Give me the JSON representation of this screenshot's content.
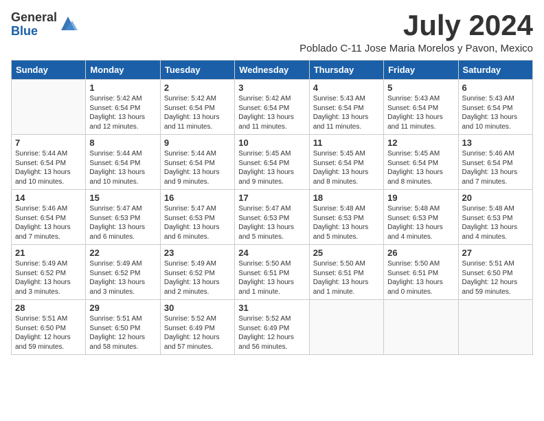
{
  "logo": {
    "general": "General",
    "blue": "Blue"
  },
  "title": "July 2024",
  "subtitle": "Poblado C-11 Jose Maria Morelos y Pavon, Mexico",
  "days_of_week": [
    "Sunday",
    "Monday",
    "Tuesday",
    "Wednesday",
    "Thursday",
    "Friday",
    "Saturday"
  ],
  "weeks": [
    [
      {
        "day": "",
        "info": ""
      },
      {
        "day": "1",
        "info": "Sunrise: 5:42 AM\nSunset: 6:54 PM\nDaylight: 13 hours\nand 12 minutes."
      },
      {
        "day": "2",
        "info": "Sunrise: 5:42 AM\nSunset: 6:54 PM\nDaylight: 13 hours\nand 11 minutes."
      },
      {
        "day": "3",
        "info": "Sunrise: 5:42 AM\nSunset: 6:54 PM\nDaylight: 13 hours\nand 11 minutes."
      },
      {
        "day": "4",
        "info": "Sunrise: 5:43 AM\nSunset: 6:54 PM\nDaylight: 13 hours\nand 11 minutes."
      },
      {
        "day": "5",
        "info": "Sunrise: 5:43 AM\nSunset: 6:54 PM\nDaylight: 13 hours\nand 11 minutes."
      },
      {
        "day": "6",
        "info": "Sunrise: 5:43 AM\nSunset: 6:54 PM\nDaylight: 13 hours\nand 10 minutes."
      }
    ],
    [
      {
        "day": "7",
        "info": "Sunrise: 5:44 AM\nSunset: 6:54 PM\nDaylight: 13 hours\nand 10 minutes."
      },
      {
        "day": "8",
        "info": "Sunrise: 5:44 AM\nSunset: 6:54 PM\nDaylight: 13 hours\nand 10 minutes."
      },
      {
        "day": "9",
        "info": "Sunrise: 5:44 AM\nSunset: 6:54 PM\nDaylight: 13 hours\nand 9 minutes."
      },
      {
        "day": "10",
        "info": "Sunrise: 5:45 AM\nSunset: 6:54 PM\nDaylight: 13 hours\nand 9 minutes."
      },
      {
        "day": "11",
        "info": "Sunrise: 5:45 AM\nSunset: 6:54 PM\nDaylight: 13 hours\nand 8 minutes."
      },
      {
        "day": "12",
        "info": "Sunrise: 5:45 AM\nSunset: 6:54 PM\nDaylight: 13 hours\nand 8 minutes."
      },
      {
        "day": "13",
        "info": "Sunrise: 5:46 AM\nSunset: 6:54 PM\nDaylight: 13 hours\nand 7 minutes."
      }
    ],
    [
      {
        "day": "14",
        "info": "Sunrise: 5:46 AM\nSunset: 6:54 PM\nDaylight: 13 hours\nand 7 minutes."
      },
      {
        "day": "15",
        "info": "Sunrise: 5:47 AM\nSunset: 6:53 PM\nDaylight: 13 hours\nand 6 minutes."
      },
      {
        "day": "16",
        "info": "Sunrise: 5:47 AM\nSunset: 6:53 PM\nDaylight: 13 hours\nand 6 minutes."
      },
      {
        "day": "17",
        "info": "Sunrise: 5:47 AM\nSunset: 6:53 PM\nDaylight: 13 hours\nand 5 minutes."
      },
      {
        "day": "18",
        "info": "Sunrise: 5:48 AM\nSunset: 6:53 PM\nDaylight: 13 hours\nand 5 minutes."
      },
      {
        "day": "19",
        "info": "Sunrise: 5:48 AM\nSunset: 6:53 PM\nDaylight: 13 hours\nand 4 minutes."
      },
      {
        "day": "20",
        "info": "Sunrise: 5:48 AM\nSunset: 6:53 PM\nDaylight: 13 hours\nand 4 minutes."
      }
    ],
    [
      {
        "day": "21",
        "info": "Sunrise: 5:49 AM\nSunset: 6:52 PM\nDaylight: 13 hours\nand 3 minutes."
      },
      {
        "day": "22",
        "info": "Sunrise: 5:49 AM\nSunset: 6:52 PM\nDaylight: 13 hours\nand 3 minutes."
      },
      {
        "day": "23",
        "info": "Sunrise: 5:49 AM\nSunset: 6:52 PM\nDaylight: 13 hours\nand 2 minutes."
      },
      {
        "day": "24",
        "info": "Sunrise: 5:50 AM\nSunset: 6:51 PM\nDaylight: 13 hours\nand 1 minute."
      },
      {
        "day": "25",
        "info": "Sunrise: 5:50 AM\nSunset: 6:51 PM\nDaylight: 13 hours\nand 1 minute."
      },
      {
        "day": "26",
        "info": "Sunrise: 5:50 AM\nSunset: 6:51 PM\nDaylight: 13 hours\nand 0 minutes."
      },
      {
        "day": "27",
        "info": "Sunrise: 5:51 AM\nSunset: 6:50 PM\nDaylight: 12 hours\nand 59 minutes."
      }
    ],
    [
      {
        "day": "28",
        "info": "Sunrise: 5:51 AM\nSunset: 6:50 PM\nDaylight: 12 hours\nand 59 minutes."
      },
      {
        "day": "29",
        "info": "Sunrise: 5:51 AM\nSunset: 6:50 PM\nDaylight: 12 hours\nand 58 minutes."
      },
      {
        "day": "30",
        "info": "Sunrise: 5:52 AM\nSunset: 6:49 PM\nDaylight: 12 hours\nand 57 minutes."
      },
      {
        "day": "31",
        "info": "Sunrise: 5:52 AM\nSunset: 6:49 PM\nDaylight: 12 hours\nand 56 minutes."
      },
      {
        "day": "",
        "info": ""
      },
      {
        "day": "",
        "info": ""
      },
      {
        "day": "",
        "info": ""
      }
    ]
  ]
}
